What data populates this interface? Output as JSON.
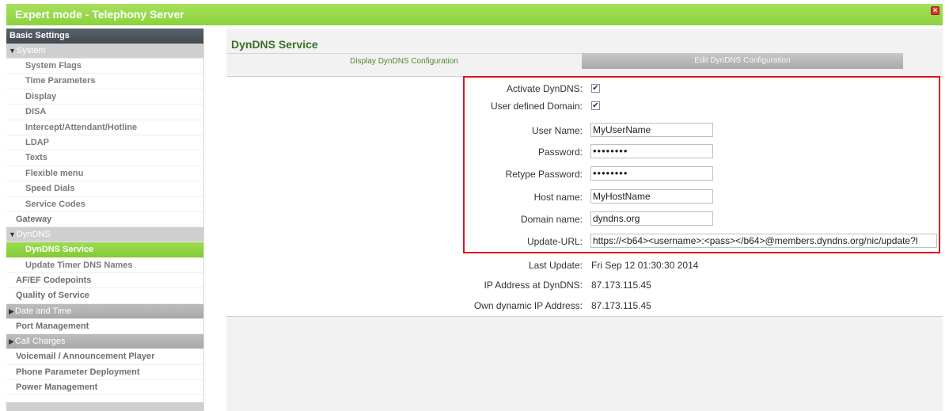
{
  "window": {
    "title": "Expert mode - Telephony Server",
    "close_glyph": "×"
  },
  "sidebar": {
    "header": "Basic Settings",
    "system_group": "System",
    "system_items": [
      "System Flags",
      "Time Parameters",
      "Display",
      "DISA",
      "Intercept/Attendant/Hotline",
      "LDAP",
      "Texts",
      "Flexible menu",
      "Speed Dials",
      "Service Codes"
    ],
    "gateway": "Gateway",
    "dyndns_group": "DynDNS",
    "dyndns_items": [
      "DynDNS Service",
      "Update Timer DNS Names"
    ],
    "afef": "AF/EF Codepoints",
    "qos": "Quality of Service",
    "date_time_group": "Date and Time",
    "port_mgmt": "Port Management",
    "call_charges_group": "Call Charges",
    "voicemail": "Voicemail / Announcement Player",
    "phone_param": "Phone Parameter Deployment",
    "power_mgmt": "Power Management"
  },
  "main": {
    "section_title": "DynDNS Service",
    "tabs": [
      "Display DynDNS Configuration",
      "Edit DynDNS Configuration"
    ]
  },
  "form": {
    "activate_label": "Activate DynDNS:",
    "activate_checked": true,
    "user_domain_label": "User defined Domain:",
    "user_domain_checked": true,
    "user_name_label": "User Name:",
    "user_name_value": "MyUserName",
    "password_label": "Password:",
    "password_value": "••••••••",
    "retype_label": "Retype Password:",
    "retype_value": "••••••••",
    "host_label": "Host name:",
    "host_value": "MyHostName",
    "domain_label": "Domain name:",
    "domain_value": "dyndns.org",
    "url_label": "Update-URL:",
    "url_value": "https://<b64><username>:<pass></b64>@members.dyndns.org/nic/update?l",
    "last_update_label": "Last Update:",
    "last_update_value": "Fri Sep 12 01:30:30 2014",
    "ip_dyndns_label": "IP Address at DynDNS:",
    "ip_dyndns_value": "87.173.115.45",
    "own_ip_label": "Own dynamic IP Address:",
    "own_ip_value": "87.173.115.45"
  },
  "colors": {
    "accent_green": "#8cd23e",
    "highlight_red": "#e0141b",
    "sidebar_header": "#4b535a"
  }
}
